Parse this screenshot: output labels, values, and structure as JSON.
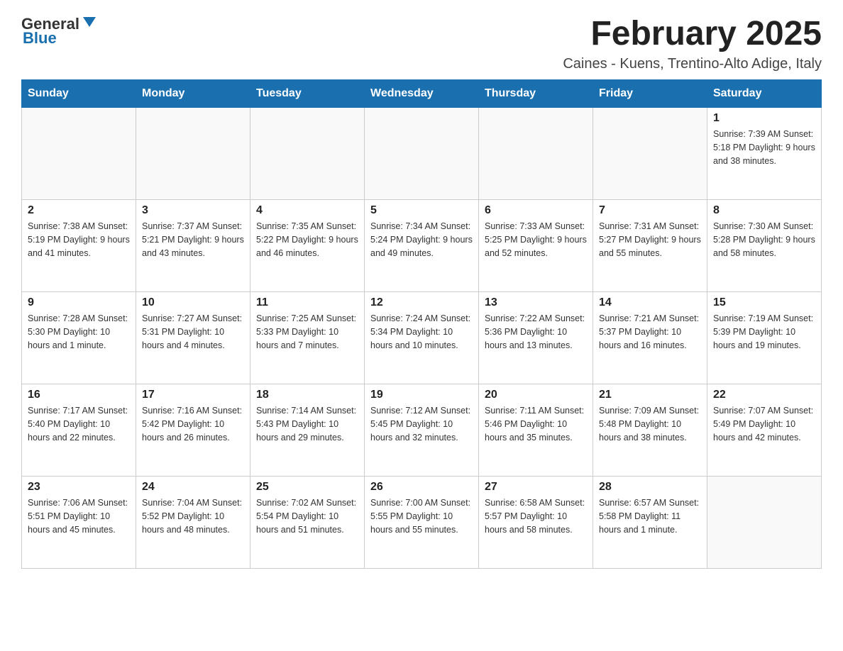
{
  "logo": {
    "general": "General",
    "blue": "Blue"
  },
  "header": {
    "title": "February 2025",
    "subtitle": "Caines - Kuens, Trentino-Alto Adige, Italy"
  },
  "weekdays": [
    "Sunday",
    "Monday",
    "Tuesday",
    "Wednesday",
    "Thursday",
    "Friday",
    "Saturday"
  ],
  "weeks": [
    [
      {
        "day": "",
        "info": ""
      },
      {
        "day": "",
        "info": ""
      },
      {
        "day": "",
        "info": ""
      },
      {
        "day": "",
        "info": ""
      },
      {
        "day": "",
        "info": ""
      },
      {
        "day": "",
        "info": ""
      },
      {
        "day": "1",
        "info": "Sunrise: 7:39 AM\nSunset: 5:18 PM\nDaylight: 9 hours and 38 minutes."
      }
    ],
    [
      {
        "day": "2",
        "info": "Sunrise: 7:38 AM\nSunset: 5:19 PM\nDaylight: 9 hours and 41 minutes."
      },
      {
        "day": "3",
        "info": "Sunrise: 7:37 AM\nSunset: 5:21 PM\nDaylight: 9 hours and 43 minutes."
      },
      {
        "day": "4",
        "info": "Sunrise: 7:35 AM\nSunset: 5:22 PM\nDaylight: 9 hours and 46 minutes."
      },
      {
        "day": "5",
        "info": "Sunrise: 7:34 AM\nSunset: 5:24 PM\nDaylight: 9 hours and 49 minutes."
      },
      {
        "day": "6",
        "info": "Sunrise: 7:33 AM\nSunset: 5:25 PM\nDaylight: 9 hours and 52 minutes."
      },
      {
        "day": "7",
        "info": "Sunrise: 7:31 AM\nSunset: 5:27 PM\nDaylight: 9 hours and 55 minutes."
      },
      {
        "day": "8",
        "info": "Sunrise: 7:30 AM\nSunset: 5:28 PM\nDaylight: 9 hours and 58 minutes."
      }
    ],
    [
      {
        "day": "9",
        "info": "Sunrise: 7:28 AM\nSunset: 5:30 PM\nDaylight: 10 hours and 1 minute."
      },
      {
        "day": "10",
        "info": "Sunrise: 7:27 AM\nSunset: 5:31 PM\nDaylight: 10 hours and 4 minutes."
      },
      {
        "day": "11",
        "info": "Sunrise: 7:25 AM\nSunset: 5:33 PM\nDaylight: 10 hours and 7 minutes."
      },
      {
        "day": "12",
        "info": "Sunrise: 7:24 AM\nSunset: 5:34 PM\nDaylight: 10 hours and 10 minutes."
      },
      {
        "day": "13",
        "info": "Sunrise: 7:22 AM\nSunset: 5:36 PM\nDaylight: 10 hours and 13 minutes."
      },
      {
        "day": "14",
        "info": "Sunrise: 7:21 AM\nSunset: 5:37 PM\nDaylight: 10 hours and 16 minutes."
      },
      {
        "day": "15",
        "info": "Sunrise: 7:19 AM\nSunset: 5:39 PM\nDaylight: 10 hours and 19 minutes."
      }
    ],
    [
      {
        "day": "16",
        "info": "Sunrise: 7:17 AM\nSunset: 5:40 PM\nDaylight: 10 hours and 22 minutes."
      },
      {
        "day": "17",
        "info": "Sunrise: 7:16 AM\nSunset: 5:42 PM\nDaylight: 10 hours and 26 minutes."
      },
      {
        "day": "18",
        "info": "Sunrise: 7:14 AM\nSunset: 5:43 PM\nDaylight: 10 hours and 29 minutes."
      },
      {
        "day": "19",
        "info": "Sunrise: 7:12 AM\nSunset: 5:45 PM\nDaylight: 10 hours and 32 minutes."
      },
      {
        "day": "20",
        "info": "Sunrise: 7:11 AM\nSunset: 5:46 PM\nDaylight: 10 hours and 35 minutes."
      },
      {
        "day": "21",
        "info": "Sunrise: 7:09 AM\nSunset: 5:48 PM\nDaylight: 10 hours and 38 minutes."
      },
      {
        "day": "22",
        "info": "Sunrise: 7:07 AM\nSunset: 5:49 PM\nDaylight: 10 hours and 42 minutes."
      }
    ],
    [
      {
        "day": "23",
        "info": "Sunrise: 7:06 AM\nSunset: 5:51 PM\nDaylight: 10 hours and 45 minutes."
      },
      {
        "day": "24",
        "info": "Sunrise: 7:04 AM\nSunset: 5:52 PM\nDaylight: 10 hours and 48 minutes."
      },
      {
        "day": "25",
        "info": "Sunrise: 7:02 AM\nSunset: 5:54 PM\nDaylight: 10 hours and 51 minutes."
      },
      {
        "day": "26",
        "info": "Sunrise: 7:00 AM\nSunset: 5:55 PM\nDaylight: 10 hours and 55 minutes."
      },
      {
        "day": "27",
        "info": "Sunrise: 6:58 AM\nSunset: 5:57 PM\nDaylight: 10 hours and 58 minutes."
      },
      {
        "day": "28",
        "info": "Sunrise: 6:57 AM\nSunset: 5:58 PM\nDaylight: 11 hours and 1 minute."
      },
      {
        "day": "",
        "info": ""
      }
    ]
  ]
}
